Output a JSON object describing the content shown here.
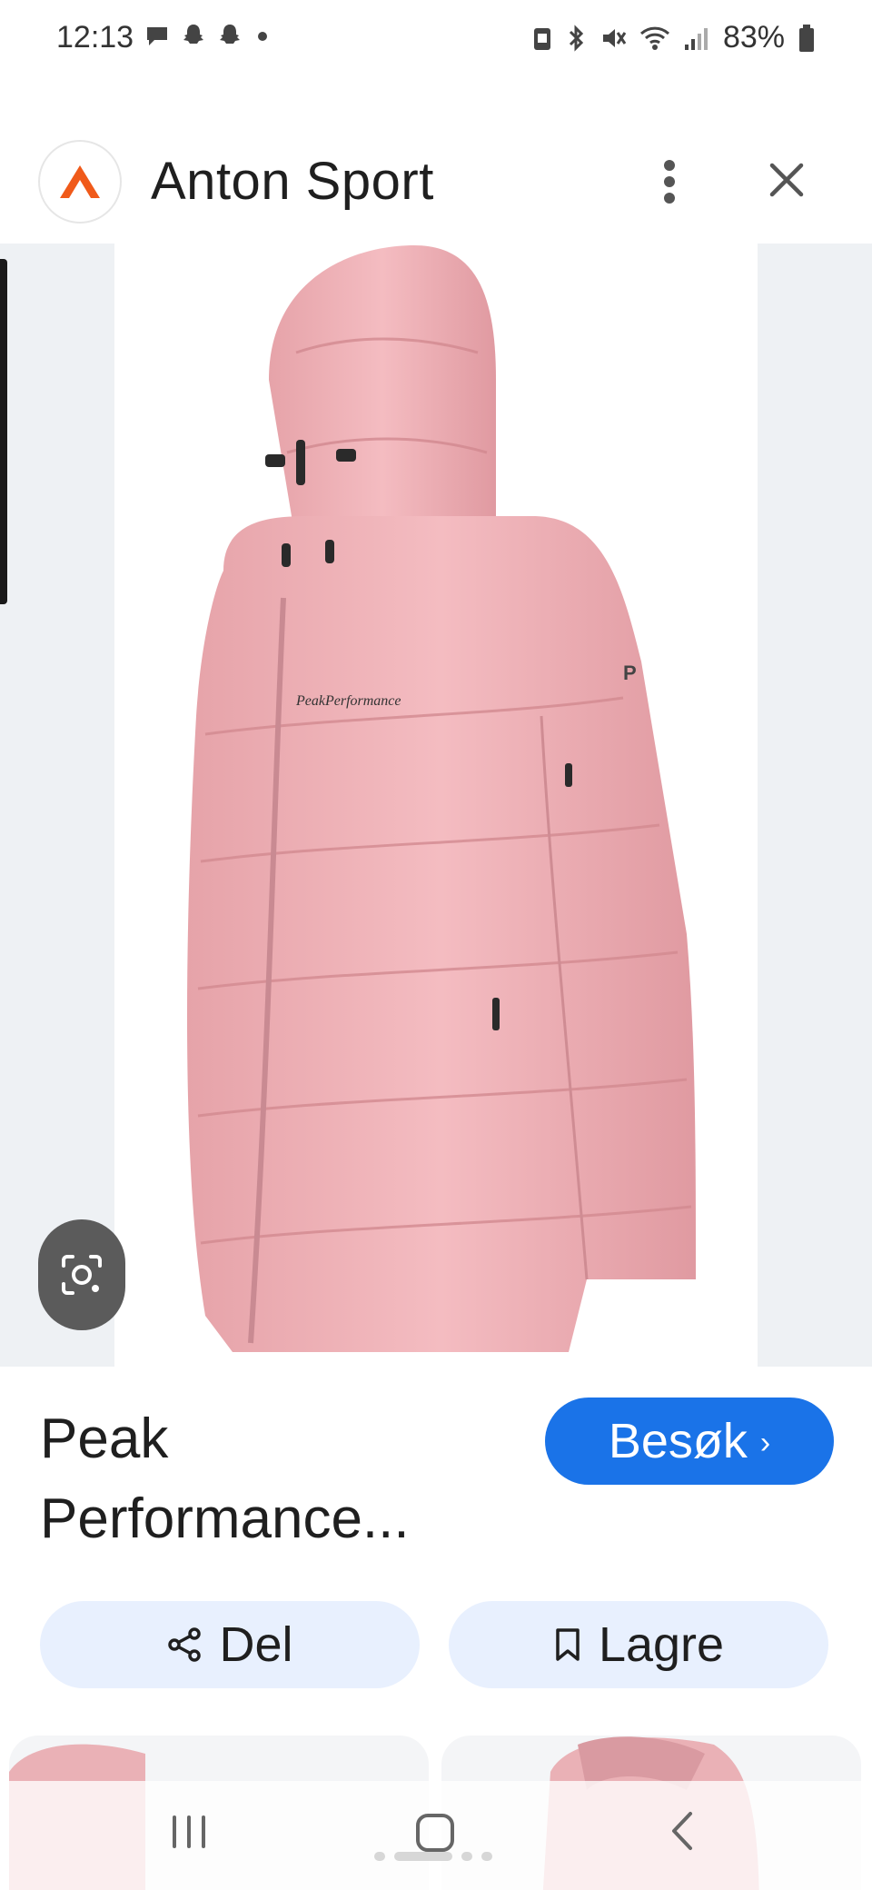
{
  "status_bar": {
    "time": "12:13",
    "battery": "83%",
    "notification_icons": [
      "chat-bubble-icon",
      "snapchat-icon",
      "snapchat-icon",
      "dot-icon"
    ],
    "system_icons": [
      "battery-saver-icon",
      "bluetooth-icon",
      "mute-icon",
      "wifi-icon",
      "signal-icon",
      "battery-icon"
    ]
  },
  "header": {
    "site_name": "Anton Sport",
    "logo_icon": "anton-sport-logo-icon",
    "menu_icon": "more-vert-icon",
    "close_icon": "close-icon"
  },
  "product": {
    "title_line1": "Peak",
    "title_line2": "Performance...",
    "image_alt": "Pink Peak Performance hooded down jacket",
    "jacket_color": "#f0b3b8",
    "visit_label": "Besøk",
    "visit_chevron": "›"
  },
  "actions": {
    "share_label": "Del",
    "save_label": "Lagre"
  },
  "colors": {
    "accent": "#1a73e8",
    "chip_bg": "#e8f0fe",
    "logo_orange": "#f05a1a"
  },
  "nav": {
    "icons": [
      "recent-apps-icon",
      "home-icon",
      "back-icon"
    ]
  }
}
